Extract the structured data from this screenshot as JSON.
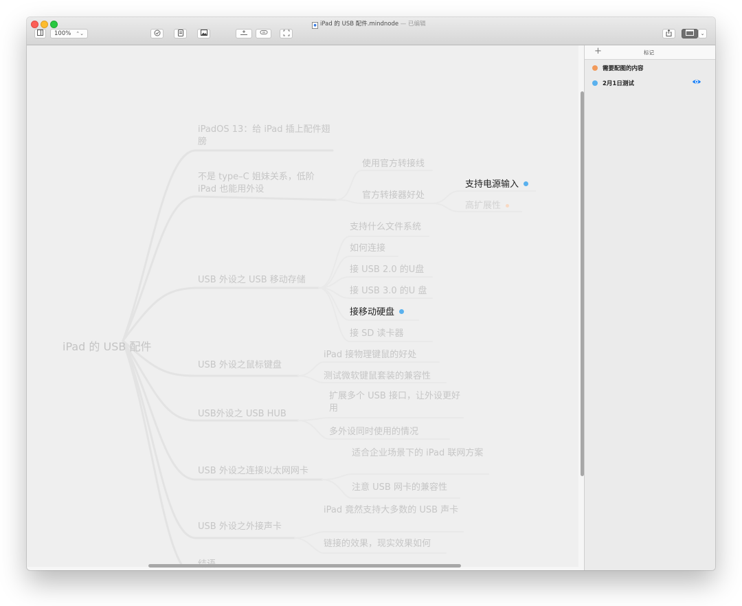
{
  "window": {
    "title": "iPad 的 USB 配件.mindnode",
    "title_suffix": " — 已编辑"
  },
  "toolbar": {
    "zoom": "100%"
  },
  "colors": {
    "accent_blue": "#5ab1ee",
    "accent_orange": "#f29a5b",
    "eye_blue": "#1a7ff5"
  },
  "mindmap": {
    "root": "iPad 的 USB 配件",
    "branch1": "iPadOS 13：给 iPad 插上配件翅膀",
    "branch2": "不是 type–C 姐妹关系，低阶 iPad 也能用外设",
    "b2_child1": "使用官方转接线",
    "b2_child2": "官方转接器好处",
    "b2_grand1": "支持电源输入",
    "b2_grand2": "高扩展性",
    "branch3": "USB 外设之 USB 移动存储",
    "b3_child1": "支持什么文件系统",
    "b3_child2": "如何连接",
    "b3_child3": "接 USB 2.0 的U盘",
    "b3_child4": "接 USB 3.0 的U 盘",
    "b3_child5": "接移动硬盘",
    "b3_child6": "接 SD 读卡器",
    "branch4": "USB 外设之鼠标键盘",
    "b4_child1": "iPad 接物理键鼠的好处",
    "b4_child2": "测试微软键鼠套装的兼容性",
    "branch5": "USB外设之 USB HUB",
    "b5_child1": "扩展多个 USB 接口，让外设更好用",
    "b5_child2": "多外设同时使用的情况",
    "branch6": "USB 外设之连接以太网网卡",
    "b6_child1": "适合企业场景下的 iPad 联网方案",
    "b6_child2": "注意 USB 网卡的兼容性",
    "branch7": "USB 外设之外接声卡",
    "b7_child1": "iPad 竟然支持大多数的 USB 声卡",
    "b7_child2": "链接的效果，现实效果如何",
    "branch8": "结语"
  },
  "sidebar": {
    "title": "标记",
    "tags": [
      {
        "label": "需要配图的内容",
        "color": "#f29a5b"
      },
      {
        "label": "2月1日测试",
        "color": "#5ab1ee",
        "visible_icon": "eye-icon"
      }
    ]
  }
}
